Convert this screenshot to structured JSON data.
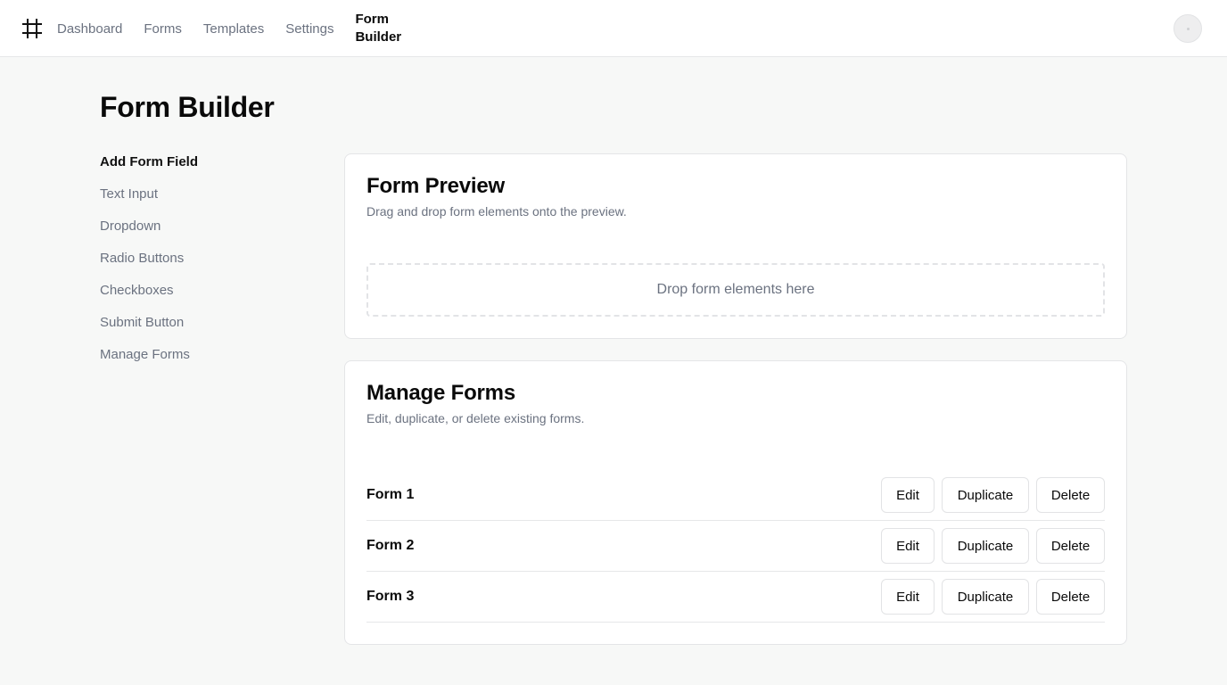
{
  "nav": {
    "logo": "hash-logo",
    "links": [
      "Dashboard",
      "Forms",
      "Templates",
      "Settings"
    ],
    "active_line1": "Form",
    "active_line2": "Builder"
  },
  "page": {
    "title": "Form Builder"
  },
  "sidebar": {
    "items": [
      {
        "label": "Add Form Field",
        "active": true
      },
      {
        "label": "Text Input"
      },
      {
        "label": "Dropdown"
      },
      {
        "label": "Radio Buttons"
      },
      {
        "label": "Checkboxes"
      },
      {
        "label": "Submit Button"
      },
      {
        "label": "Manage Forms"
      }
    ]
  },
  "preview": {
    "title": "Form Preview",
    "description": "Drag and drop form elements onto the preview.",
    "dropzone": "Drop form elements here"
  },
  "manage": {
    "title": "Manage Forms",
    "description": "Edit, duplicate, or delete existing forms.",
    "forms": [
      {
        "name": "Form 1"
      },
      {
        "name": "Form 2"
      },
      {
        "name": "Form 3"
      }
    ],
    "actions": {
      "edit": "Edit",
      "duplicate": "Duplicate",
      "delete": "Delete"
    }
  },
  "colors": {
    "background": "#f7f8f7",
    "muted_text": "#6b7280",
    "border": "#e4e5e7"
  }
}
